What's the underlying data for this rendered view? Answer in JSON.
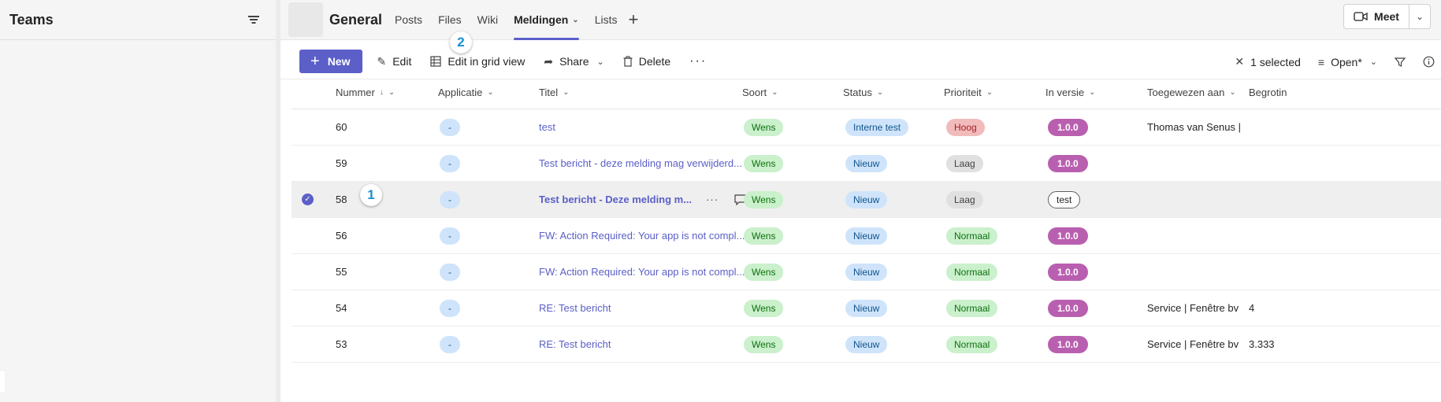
{
  "sidebar": {
    "title": "Teams"
  },
  "channel": {
    "name": "General",
    "tabs": [
      {
        "label": "Posts"
      },
      {
        "label": "Files"
      },
      {
        "label": "Wiki"
      },
      {
        "label": "Meldingen",
        "active": true
      },
      {
        "label": "Lists"
      }
    ],
    "meet_label": "Meet"
  },
  "toolbar": {
    "new_label": "New",
    "edit_label": "Edit",
    "grid_label": "Edit in grid view",
    "share_label": "Share",
    "delete_label": "Delete",
    "more_label": "···",
    "selected_label": "1 selected",
    "view_label": "Open*"
  },
  "callouts": [
    "1",
    "2"
  ],
  "columns": [
    "Nummer",
    "Applicatie",
    "Titel",
    "Soort",
    "Status",
    "Prioriteit",
    "In versie",
    "Toegewezen aan",
    "Begrotin"
  ],
  "rows": [
    {
      "nummer": "60",
      "app": "-",
      "titel": "test",
      "soort": "Wens",
      "status": "Interne test",
      "prio": "Hoog",
      "versie": "1.0.0",
      "toegewezen": "Thomas van Senus | Fe",
      "begroting": ""
    },
    {
      "nummer": "59",
      "app": "-",
      "titel": "Test bericht - deze melding mag verwijderd...",
      "soort": "Wens",
      "status": "Nieuw",
      "prio": "Laag",
      "versie": "1.0.0",
      "toegewezen": "",
      "begroting": ""
    },
    {
      "nummer": "58",
      "app": "-",
      "titel": "Test bericht - Deze melding m...",
      "soort": "Wens",
      "status": "Nieuw",
      "prio": "Laag",
      "versie": "test",
      "toegewezen": "",
      "begroting": "",
      "selected": true
    },
    {
      "nummer": "56",
      "app": "-",
      "titel": "FW: Action Required: Your app is not compl...",
      "soort": "Wens",
      "status": "Nieuw",
      "prio": "Normaal",
      "versie": "1.0.0",
      "toegewezen": "",
      "begroting": ""
    },
    {
      "nummer": "55",
      "app": "-",
      "titel": "FW: Action Required: Your app is not compl...",
      "soort": "Wens",
      "status": "Nieuw",
      "prio": "Normaal",
      "versie": "1.0.0",
      "toegewezen": "",
      "begroting": ""
    },
    {
      "nummer": "54",
      "app": "-",
      "titel": "RE: Test bericht",
      "soort": "Wens",
      "status": "Nieuw",
      "prio": "Normaal",
      "versie": "1.0.0",
      "toegewezen": "Service | Fenêtre bv",
      "begroting": "4"
    },
    {
      "nummer": "53",
      "app": "-",
      "titel": "RE: Test bericht",
      "soort": "Wens",
      "status": "Nieuw",
      "prio": "Normaal",
      "versie": "1.0.0",
      "toegewezen": "Service | Fenêtre bv",
      "begroting": "3.333"
    }
  ]
}
